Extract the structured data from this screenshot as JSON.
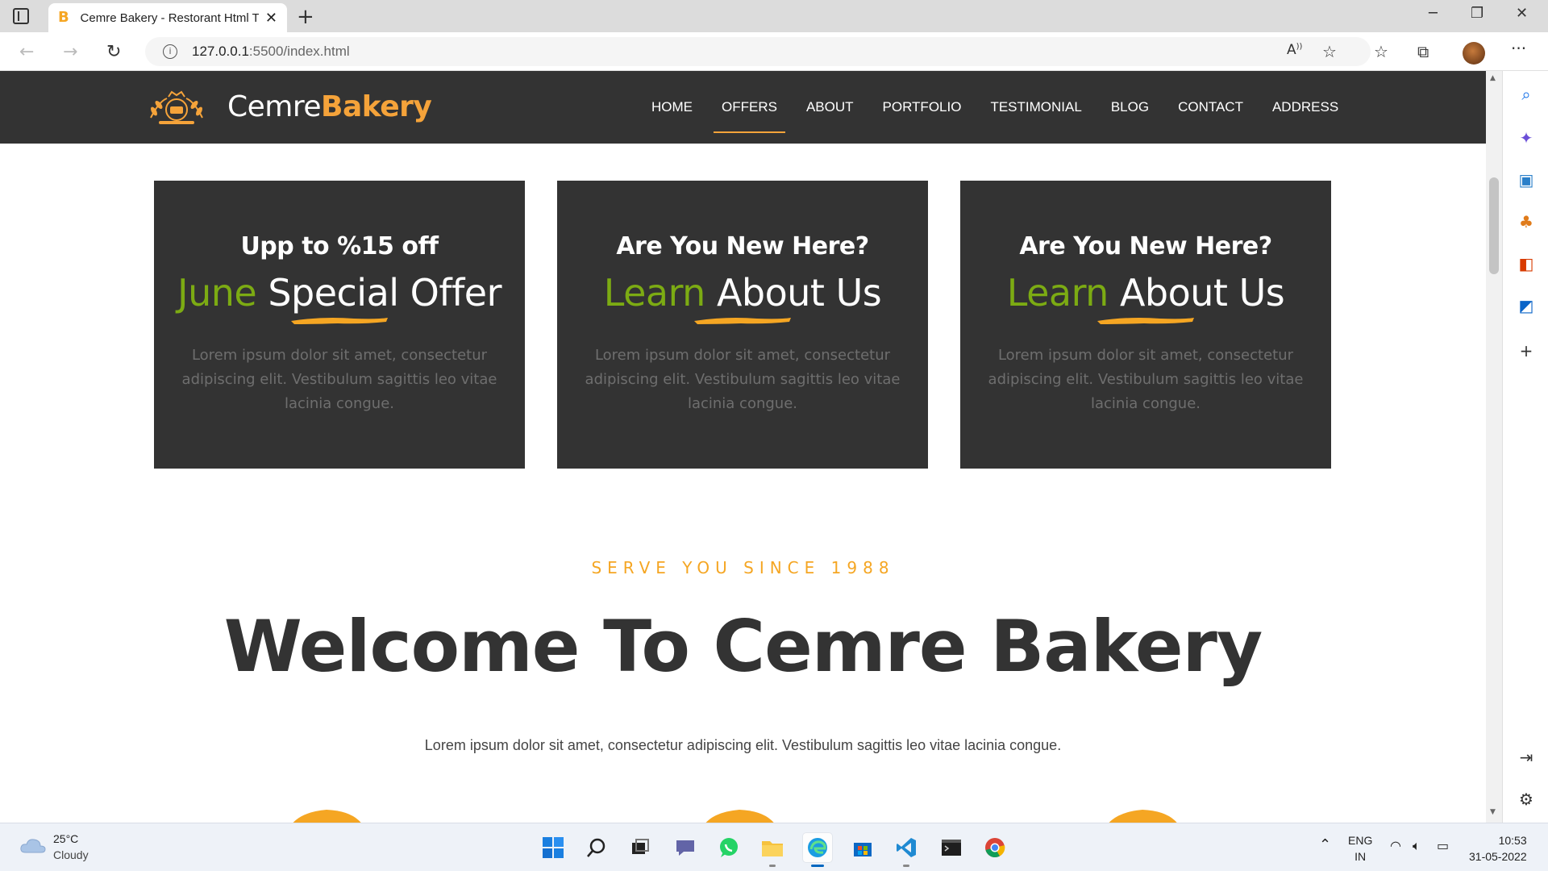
{
  "browser": {
    "tab_title": "Cemre Bakery - Restorant Html T",
    "tab_favicon": "B",
    "url_host": "127.0.0.1",
    "url_rest": ":5500/index.html"
  },
  "site": {
    "logo_light": "Cemre",
    "logo_bold": "Bakery",
    "nav": [
      {
        "label": "HOME"
      },
      {
        "label": "OFFERS"
      },
      {
        "label": "ABOUT"
      },
      {
        "label": "PORTFOLIO"
      },
      {
        "label": "TESTIMONIAL"
      },
      {
        "label": "BLOG"
      },
      {
        "label": "CONTACT"
      },
      {
        "label": "ADDRESS"
      }
    ],
    "active_nav": "OFFERS",
    "cards": [
      {
        "kicker": "Upp to %15 off",
        "title_green": "June",
        "title_white": "Special Offer",
        "body": "Lorem ipsum dolor sit amet, consectetur adipiscing elit. Vestibulum sagittis leo vitae lacinia congue."
      },
      {
        "kicker": "Are You New Here?",
        "title_green": "Learn",
        "title_white": "About Us",
        "body": "Lorem ipsum dolor sit amet, consectetur adipiscing elit. Vestibulum sagittis leo vitae lacinia congue."
      },
      {
        "kicker": "Are You New Here?",
        "title_green": "Learn",
        "title_white": "About Us",
        "body": "Lorem ipsum dolor sit amet, consectetur adipiscing elit. Vestibulum sagittis leo vitae lacinia congue."
      }
    ],
    "serve_since": "SERVE YOU SINCE 1988",
    "welcome_heading": "Welcome To Cemre Bakery",
    "welcome_text": "Lorem ipsum dolor sit amet, consectetur adipiscing elit. Vestibulum sagittis leo vitae lacinia congue."
  },
  "colors": {
    "header_bg": "#333333",
    "accent_orange": "#f5a33a",
    "accent_green": "#7cab13"
  },
  "taskbar": {
    "temperature": "25°C",
    "weather": "Cloudy",
    "lang_top": "ENG",
    "lang_bottom": "IN",
    "time": "10:53",
    "date": "31-05-2022"
  }
}
